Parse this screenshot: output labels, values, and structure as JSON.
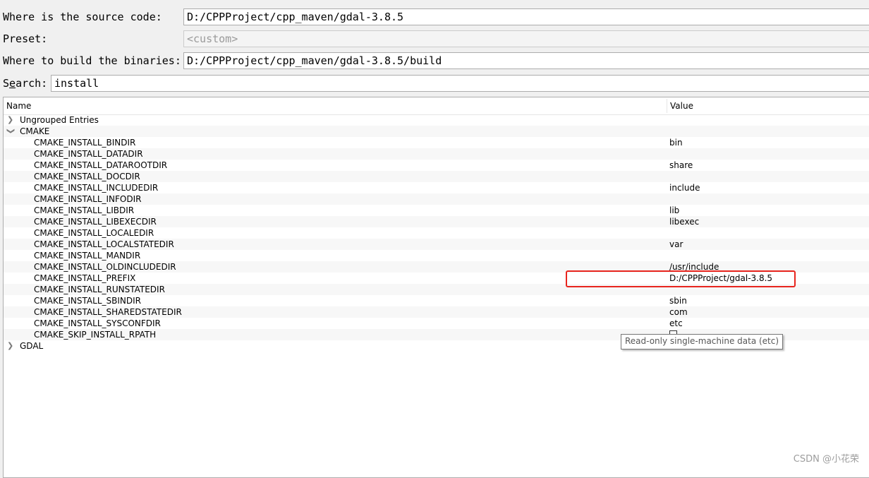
{
  "source_label": "Where is the source code:",
  "source_value": "D:/CPPProject/cpp_maven/gdal-3.8.5",
  "preset_label": "Preset:",
  "preset_value": "<custom>",
  "build_label": "Where to build the binaries:",
  "build_value": "D:/CPPProject/cpp_maven/gdal-3.8.5/build",
  "search_label": "Search:",
  "search_value": "install",
  "columns": {
    "name": "Name",
    "value": "Value"
  },
  "groups": {
    "ungrouped": "Ungrouped Entries",
    "cmake": "CMAKE",
    "gdal": "GDAL"
  },
  "entries": [
    {
      "name": "CMAKE_INSTALL_BINDIR",
      "value": "bin"
    },
    {
      "name": "CMAKE_INSTALL_DATADIR",
      "value": ""
    },
    {
      "name": "CMAKE_INSTALL_DATAROOTDIR",
      "value": "share"
    },
    {
      "name": "CMAKE_INSTALL_DOCDIR",
      "value": ""
    },
    {
      "name": "CMAKE_INSTALL_INCLUDEDIR",
      "value": "include"
    },
    {
      "name": "CMAKE_INSTALL_INFODIR",
      "value": ""
    },
    {
      "name": "CMAKE_INSTALL_LIBDIR",
      "value": "lib"
    },
    {
      "name": "CMAKE_INSTALL_LIBEXECDIR",
      "value": "libexec"
    },
    {
      "name": "CMAKE_INSTALL_LOCALEDIR",
      "value": ""
    },
    {
      "name": "CMAKE_INSTALL_LOCALSTATEDIR",
      "value": "var"
    },
    {
      "name": "CMAKE_INSTALL_MANDIR",
      "value": ""
    },
    {
      "name": "CMAKE_INSTALL_OLDINCLUDEDIR",
      "value": "/usr/include"
    },
    {
      "name": "CMAKE_INSTALL_PREFIX",
      "value": "D:/CPPProject/gdal-3.8.5"
    },
    {
      "name": "CMAKE_INSTALL_RUNSTATEDIR",
      "value": ""
    },
    {
      "name": "CMAKE_INSTALL_SBINDIR",
      "value": "sbin"
    },
    {
      "name": "CMAKE_INSTALL_SHAREDSTATEDIR",
      "value": "com"
    },
    {
      "name": "CMAKE_INSTALL_SYSCONFDIR",
      "value": "etc"
    },
    {
      "name": "CMAKE_SKIP_INSTALL_RPATH",
      "value": "",
      "checked": false
    }
  ],
  "tooltip": "Read-only single-machine data (etc)",
  "watermark": "CSDN @小花荣",
  "icons": {
    "collapsed": "chevron-right-icon",
    "expanded": "chevron-down-icon"
  },
  "highlight_color": "#e8251e"
}
